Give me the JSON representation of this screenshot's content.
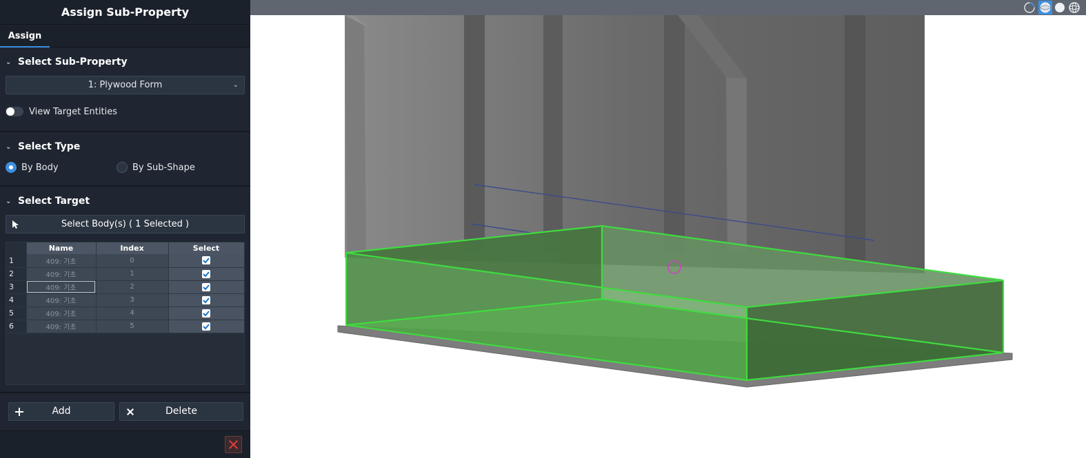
{
  "panel": {
    "title": "Assign Sub-Property",
    "tab": "Assign"
  },
  "sub_property": {
    "header": "Select Sub-Property",
    "selected": "1: Plywood Form",
    "toggle_label": "View Target Entities",
    "toggle_on": false
  },
  "select_type": {
    "header": "Select Type",
    "option_body": "By Body",
    "option_subshape": "By Sub-Shape",
    "selected": "By Body"
  },
  "select_target": {
    "header": "Select Target",
    "button_label": "Select Body(s) ( 1 Selected )",
    "columns": [
      "Name",
      "Index",
      "Select"
    ],
    "rows": [
      {
        "num": "1",
        "name": "409: 기초",
        "index": "0",
        "selected": true
      },
      {
        "num": "2",
        "name": "409: 기초",
        "index": "1",
        "selected": true
      },
      {
        "num": "3",
        "name": "409: 기초",
        "index": "2",
        "selected": true
      },
      {
        "num": "4",
        "name": "409: 기초",
        "index": "3",
        "selected": true
      },
      {
        "num": "5",
        "name": "409: 기초",
        "index": "4",
        "selected": true
      },
      {
        "num": "6",
        "name": "409: 기초",
        "index": "5",
        "selected": true
      }
    ]
  },
  "actions": {
    "add_label": "Add",
    "delete_label": "Delete"
  },
  "colors": {
    "accent": "#3d8fe0",
    "highlight_edge": "#3fdc3f",
    "highlight_fill": "#4f9a45",
    "close": "#e03a3a"
  },
  "viewport_icons": [
    "rotate-icon",
    "shaded-sphere-icon",
    "solid-sphere-icon",
    "wire-sphere-icon"
  ]
}
